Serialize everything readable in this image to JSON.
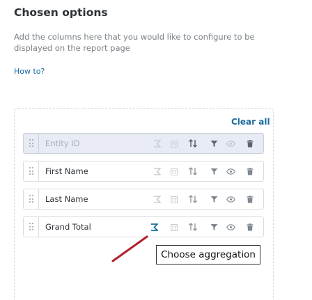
{
  "panel": {
    "title": "Chosen options",
    "description": "Add the columns here that you would like to configure to be displayed on the report page",
    "how_to_link": "How to?",
    "clear_all_label": "Clear all"
  },
  "rows": [
    {
      "label": "Entity ID",
      "disabled": true
    },
    {
      "label": "First Name",
      "disabled": false
    },
    {
      "label": "Last Name",
      "disabled": false
    },
    {
      "label": "Grand Total",
      "disabled": false,
      "aggregation_active": true
    }
  ],
  "tooltip": {
    "text": "Choose aggregation"
  },
  "colors": {
    "accent": "#1b6ca0",
    "icon_inactive": "#c9ced4",
    "icon_active": "#7d8791",
    "disabled_row_bg": "#e8ebf3",
    "annotation_arrow": "#b3202a"
  },
  "icons": [
    "drag-handle-icon",
    "aggregation-icon",
    "calendar-icon",
    "sort-icon",
    "filter-icon",
    "eye-icon",
    "trash-icon"
  ]
}
